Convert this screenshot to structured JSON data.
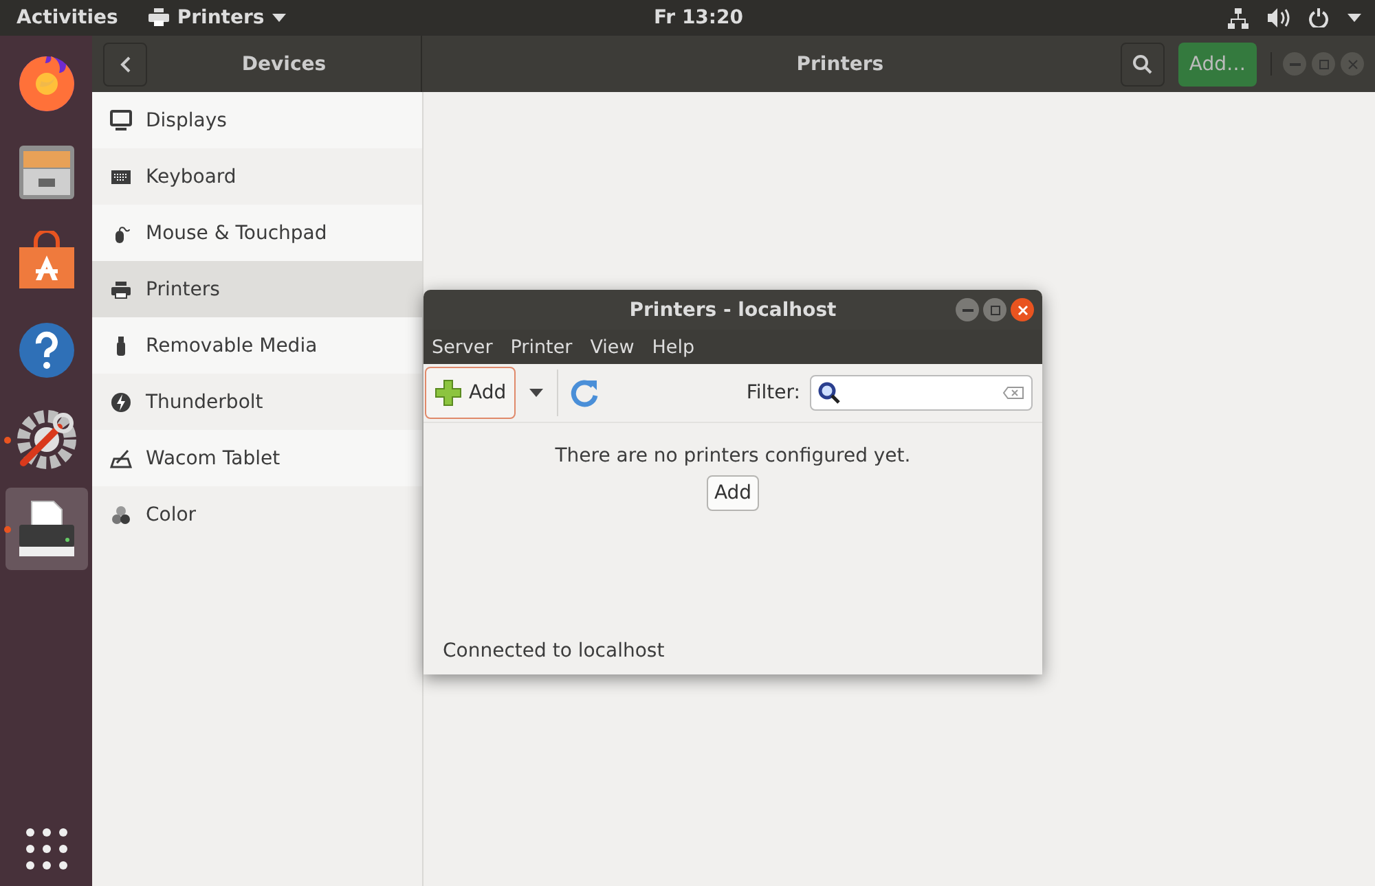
{
  "top_bar": {
    "activities": "Activities",
    "app_menu": "Printers",
    "clock": "Fr 13:20"
  },
  "dock": {
    "items": [
      {
        "kind": "browser",
        "running": false,
        "selected": false
      },
      {
        "kind": "files",
        "running": false,
        "selected": false
      },
      {
        "kind": "store",
        "running": false,
        "selected": false
      },
      {
        "kind": "help",
        "running": false,
        "selected": false
      },
      {
        "kind": "tools",
        "running": true,
        "selected": false
      },
      {
        "kind": "printer",
        "running": true,
        "selected": true
      }
    ]
  },
  "header": {
    "sidebar_title": "Devices",
    "title": "Printers",
    "add_button": "Add…"
  },
  "sidebar": {
    "items": [
      {
        "kind": "display",
        "label": "Displays",
        "selected": false
      },
      {
        "kind": "keyboard",
        "label": "Keyboard",
        "selected": false
      },
      {
        "kind": "mouse",
        "label": "Mouse & Touchpad",
        "selected": false
      },
      {
        "kind": "printer",
        "label": "Printers",
        "selected": true
      },
      {
        "kind": "usb",
        "label": "Removable Media",
        "selected": false
      },
      {
        "kind": "bolt",
        "label": "Thunderbolt",
        "selected": false
      },
      {
        "kind": "tablet",
        "label": "Wacom Tablet",
        "selected": false
      },
      {
        "kind": "color",
        "label": "Color",
        "selected": false
      }
    ]
  },
  "dialog": {
    "title": "Printers - localhost",
    "menus": [
      "Server",
      "Printer",
      "View",
      "Help"
    ],
    "add_button": "Add",
    "filter_label": "Filter:",
    "message": "There are no printers configured yet.",
    "message_button": "Add",
    "status": "Connected to localhost"
  }
}
